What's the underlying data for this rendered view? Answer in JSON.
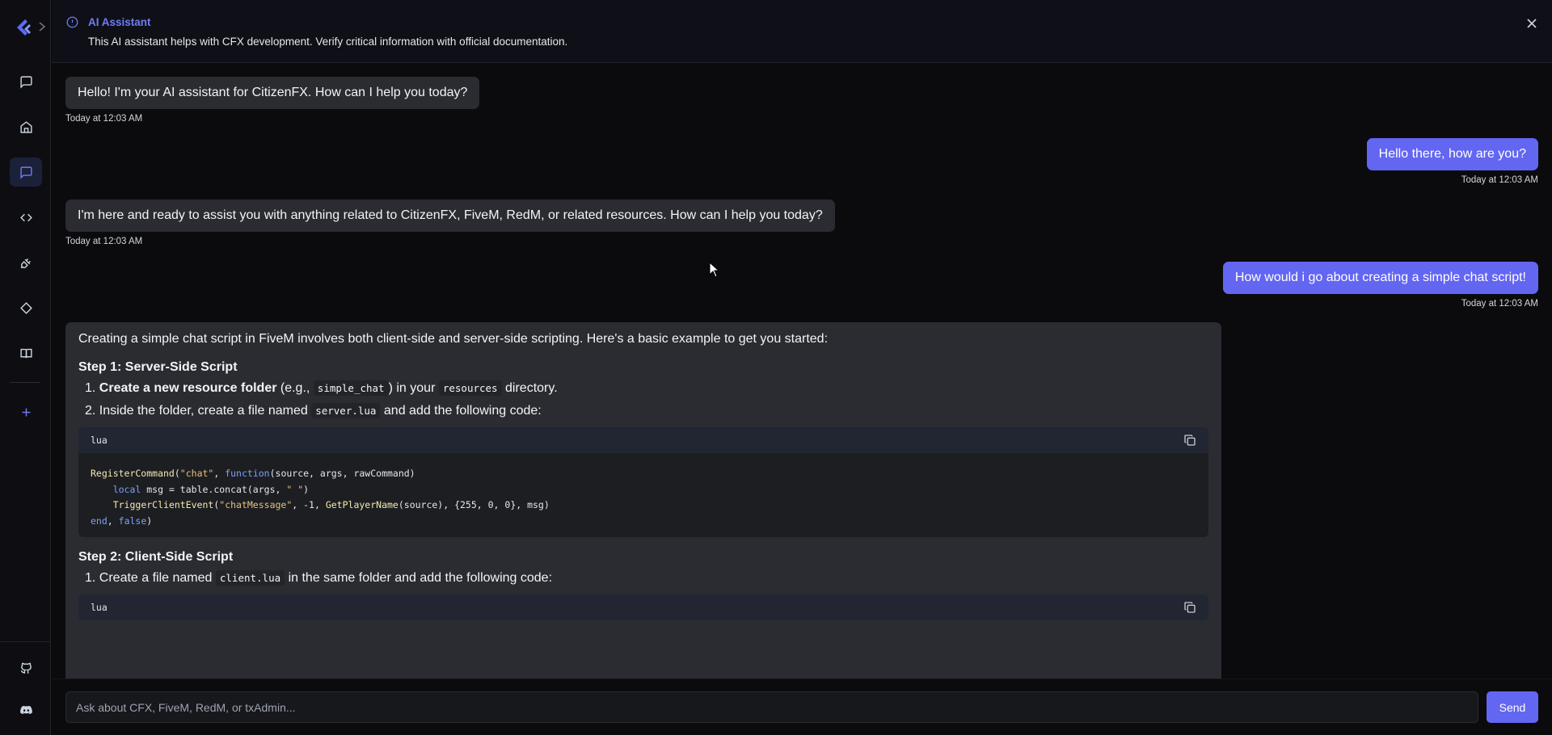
{
  "banner": {
    "title": "AI Assistant",
    "description": "This AI assistant helps with CFX development. Verify critical information with official documentation."
  },
  "sidebar": {
    "items": [
      "chat-icon",
      "home-icon",
      "chat-icon",
      "code-icon",
      "plug-icon",
      "diamond-icon",
      "book-icon",
      "plus-icon",
      "github-icon",
      "discord-icon"
    ],
    "active_index": 2
  },
  "messages": [
    {
      "role": "assistant",
      "text": "Hello! I'm your AI assistant for CitizenFX. How can I help you today?",
      "time": "Today at 12:03 AM"
    },
    {
      "role": "user",
      "text": "Hello there, how are you?",
      "time": "Today at 12:03 AM"
    },
    {
      "role": "assistant",
      "text": "I'm here and ready to assist you with anything related to CitizenFX, FiveM, RedM, or related resources. How can I help you today?",
      "time": "Today at 12:03 AM"
    },
    {
      "role": "user",
      "text": "How would i go about creating a simple chat script!",
      "time": "Today at 12:03 AM"
    }
  ],
  "answer": {
    "intro": "Creating a simple chat script in FiveM involves both client-side and server-side scripting. Here's a basic example to get you started:",
    "step1_title": "Step 1: Server-Side Script",
    "step1_item1_bold": "Create a new resource folder",
    "step1_item1_a": " (e.g., ",
    "step1_item1_code1": "simple_chat",
    "step1_item1_b": ") in your ",
    "step1_item1_code2": "resources",
    "step1_item1_c": " directory.",
    "step1_item2_a": "Inside the folder, create a file named ",
    "step1_item2_code": "server.lua",
    "step1_item2_b": " and add the following code:",
    "code1_lang": "lua",
    "step2_title": "Step 2: Client-Side Script",
    "step2_item1_a": "Create a file named ",
    "step2_item1_code": "client.lua",
    "step2_item1_b": " in the same folder and add the following code:",
    "code2_lang": "lua",
    "numbers": [
      "1.",
      "2.",
      "1."
    ]
  },
  "input": {
    "placeholder": "Ask about CFX, FiveM, RedM, or txAdmin...",
    "send_label": "Send"
  },
  "colors": {
    "accent": "#6366f1",
    "bubble_ai": "#2b2c31",
    "background": "#0b0b0e"
  }
}
